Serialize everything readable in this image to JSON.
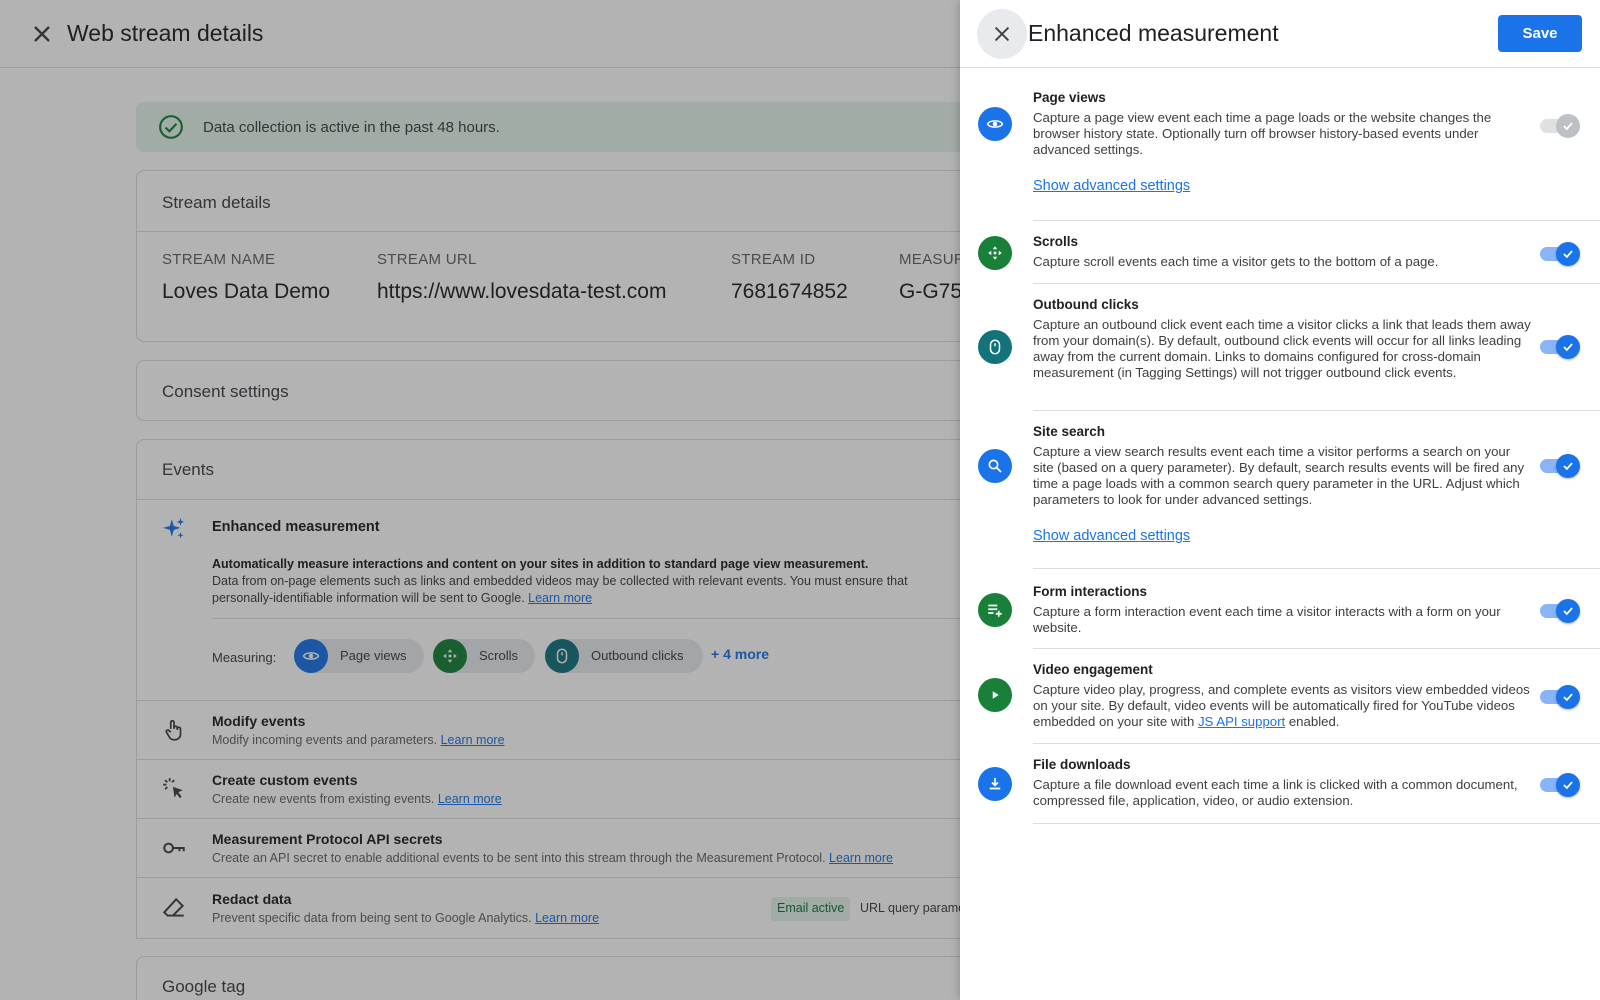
{
  "page": {
    "title": "Web stream details",
    "banner": "Data collection is active in the past 48 hours."
  },
  "stream_details": {
    "title": "Stream details",
    "fields": [
      {
        "label": "STREAM NAME",
        "value": "Loves Data Demo"
      },
      {
        "label": "STREAM URL",
        "value": "https://www.lovesdata-test.com"
      },
      {
        "label": "STREAM ID",
        "value": "7681674852"
      },
      {
        "label": "MEASUR",
        "value": "G-G75"
      }
    ]
  },
  "consent": {
    "title": "Consent settings"
  },
  "events": {
    "title": "Events",
    "enhanced": {
      "title": "Enhanced measurement",
      "desc_strong": "Automatically measure interactions and content on your sites in addition to standard page view measurement.",
      "desc_line2": "Data from on-page elements such as links and embedded videos may be collected with relevant events. You must ensure that",
      "desc_line3": "personally-identifiable information will be sent to Google.",
      "learn_more": "Learn more",
      "measuring_label": "Measuring:",
      "chips": [
        "Page views",
        "Scrolls",
        "Outbound clicks"
      ],
      "more": "+ 4 more"
    },
    "rows": [
      {
        "title": "Modify events",
        "desc": "Modify incoming events and parameters.",
        "link": "Learn more"
      },
      {
        "title": "Create custom events",
        "desc": "Create new events from existing events.",
        "link": "Learn more"
      },
      {
        "title": "Measurement Protocol API secrets",
        "desc": "Create an API secret to enable additional events to be sent into this stream through the Measurement Protocol.",
        "link": "Learn more"
      },
      {
        "title": "Redact data",
        "desc": "Prevent specific data from being sent to Google Analytics.",
        "link": "Learn more",
        "badge": "Email active",
        "badge2": "URL query parame"
      }
    ]
  },
  "google_tag": {
    "title": "Google tag"
  },
  "panel": {
    "title": "Enhanced measurement",
    "save_label": "Save",
    "show_advanced": "Show advanced settings",
    "settings": [
      {
        "title": "Page views",
        "desc": "Capture a page view event each time a page loads or the website changes the browser history state. Optionally turn off browser history-based events under advanced settings.",
        "enabled": true,
        "disabled": true
      },
      {
        "title": "Scrolls",
        "desc": "Capture scroll events each time a visitor gets to the bottom of a page.",
        "enabled": true
      },
      {
        "title": "Outbound clicks",
        "desc": "Capture an outbound click event each time a visitor clicks a link that leads them away from your domain(s). By default, outbound click events will occur for all links leading away from the current domain. Links to domains configured for cross-domain measurement (in Tagging Settings) will not trigger outbound click events.",
        "enabled": true
      },
      {
        "title": "Site search",
        "desc": "Capture a view search results event each time a visitor performs a search on your site (based on a query parameter). By default, search results events will be fired any time a page loads with a common search query parameter in the URL. Adjust which parameters to look for under advanced settings.",
        "enabled": true
      },
      {
        "title": "Form interactions",
        "desc": "Capture a form interaction event each time a visitor interacts with a form on your website.",
        "enabled": true
      },
      {
        "title": "Video engagement",
        "desc_before": "Capture video play, progress, and complete events as visitors view embedded videos on your site. By default, video events will be automatically fired for YouTube videos embedded on your site with ",
        "desc_link": "JS API support",
        "desc_after": " enabled.",
        "enabled": true
      },
      {
        "title": "File downloads",
        "desc": "Capture a file download event each time a link is clicked with a common document, compressed file, application, video, or audio extension.",
        "enabled": true
      }
    ]
  },
  "colors": {
    "accent": "#1a73e8",
    "green_icon": "#188038",
    "teal_icon": "#12737a",
    "banner_bg": "#e6f4ea"
  }
}
